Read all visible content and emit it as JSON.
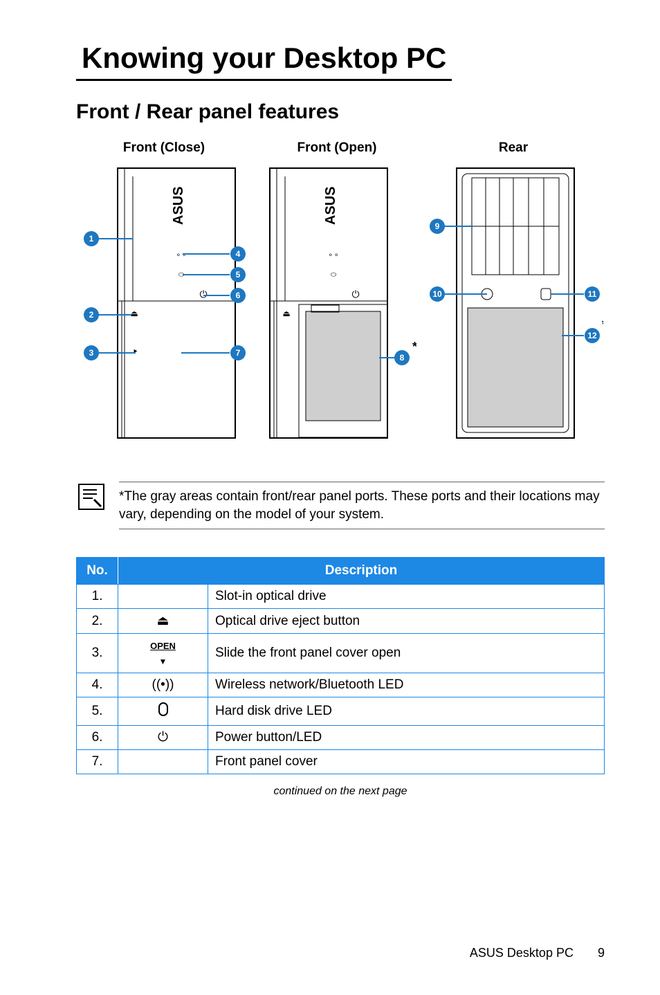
{
  "title": "Knowing your Desktop PC",
  "section": "Front / Rear panel features",
  "diagram_labels": {
    "front_close": "Front (Close)",
    "front_open": "Front (Open)",
    "rear": "Rear"
  },
  "callouts": [
    "1",
    "2",
    "3",
    "4",
    "5",
    "6",
    "7",
    "8",
    "9",
    "10",
    "11",
    "12"
  ],
  "note": "*The gray areas contain front/rear panel ports. These ports and their locations may vary, depending on the model of your system.",
  "table": {
    "headers": {
      "no": "No.",
      "desc": "Description"
    },
    "rows": [
      {
        "no": "1.",
        "icon": "",
        "desc": "Slot-in optical drive"
      },
      {
        "no": "2.",
        "icon": "eject",
        "desc": "Optical drive eject button"
      },
      {
        "no": "3.",
        "icon": "open",
        "desc": "Slide the front panel cover open"
      },
      {
        "no": "4.",
        "icon": "wireless",
        "desc": "Wireless network/Bluetooth LED"
      },
      {
        "no": "5.",
        "icon": "hdd",
        "desc": "Hard disk drive LED"
      },
      {
        "no": "6.",
        "icon": "power",
        "desc": "Power button/LED"
      },
      {
        "no": "7.",
        "icon": "",
        "desc": "Front panel cover"
      }
    ]
  },
  "continued": "continued on the next page",
  "footer": {
    "product": "ASUS Desktop PC",
    "page": "9"
  }
}
